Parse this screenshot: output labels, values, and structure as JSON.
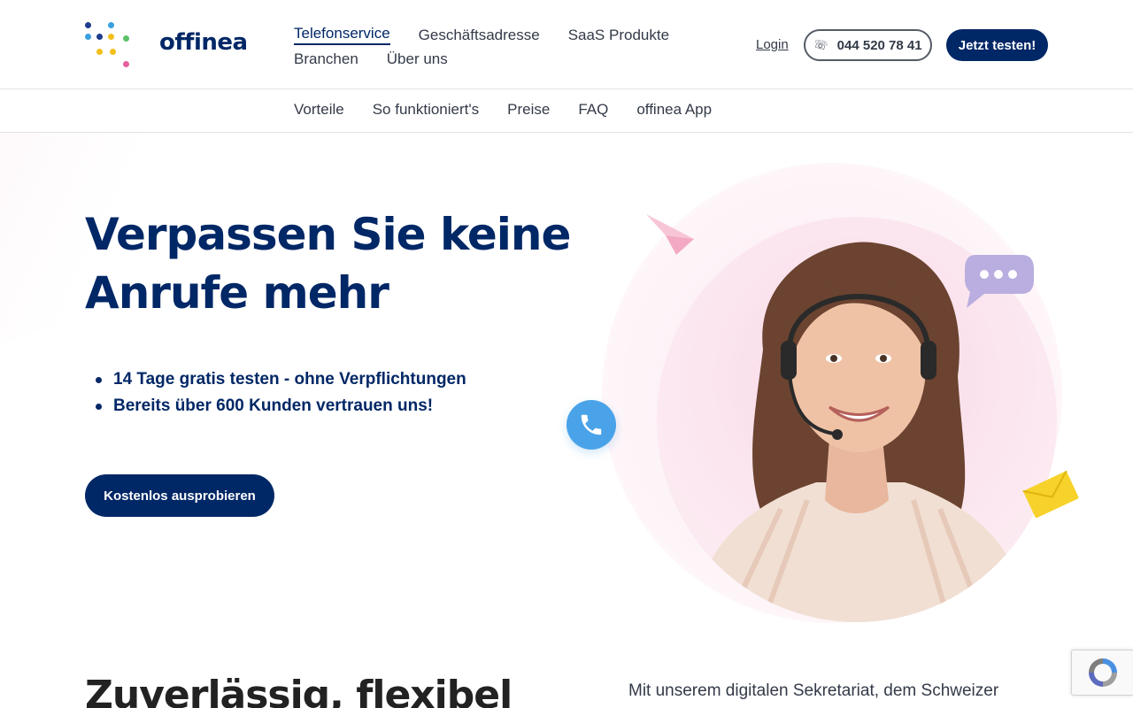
{
  "brand": {
    "name": "offinea",
    "logo_icon": "dots-icon",
    "primary_color": "#002766"
  },
  "header": {
    "nav_row1": [
      "Telefonservice",
      "Geschäftsadresse",
      "SaaS Produkte"
    ],
    "nav_row2": [
      "Branchen",
      "Über uns"
    ],
    "login": "Login",
    "phone": "044 520 78 41",
    "cta": "Jetzt testen!"
  },
  "subnav": [
    "Vorteile",
    "So funktioniert's",
    "Preise",
    "FAQ",
    "offinea App"
  ],
  "hero": {
    "title_line1": "Verpassen Sie keine",
    "title_line2": "Anrufe mehr",
    "bullets": [
      "14 Tage gratis testen - ohne Verpflichtungen",
      "Bereits über 600 Kunden vertrauen uns!"
    ],
    "cta": "Kostenlos ausprobieren",
    "illustration": {
      "icons": [
        "paper-plane-icon",
        "chat-bubble-icon",
        "phone-icon",
        "envelope-icon"
      ]
    }
  },
  "section2": {
    "title": "Zuverlässig, flexibel",
    "text": "Mit unserem digitalen Sekretariat, dem Schweizer"
  }
}
